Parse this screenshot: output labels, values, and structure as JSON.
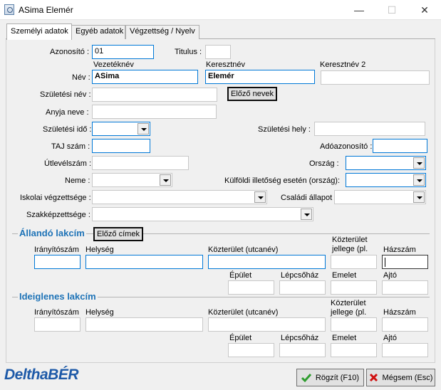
{
  "window": {
    "title": "ASima Elemér",
    "minimize": "—",
    "maximize": "☐",
    "close": "✕"
  },
  "tabs": [
    {
      "label": "Személyi adatok"
    },
    {
      "label": "Egyéb adatok"
    },
    {
      "label": "Végzettség / Nyelv"
    }
  ],
  "form": {
    "azonosito_label": "Azonosító :",
    "azonosito_value": "01",
    "titulus_label": "Titulus :",
    "titulus_value": "",
    "vezeteknev_caption": "Vezetéknév",
    "keresztnev_caption": "Keresztnév",
    "keresztnev2_caption": "Keresztnév 2",
    "nev_label": "Név :",
    "vezeteknev_value": "ASima",
    "keresztnev_value": "Elemér",
    "keresztnev2_value": "",
    "szuletesi_nev_label": "Születési név :",
    "szuletesi_nev_value": "",
    "elozo_nevek_button": "Előző nevek",
    "anyja_neve_label": "Anyja neve :",
    "anyja_neve_value": "",
    "szuletesi_ido_label": "Születési idő :",
    "szuletesi_ido_value": "",
    "szuletesi_hely_label": "Születési hely :",
    "szuletesi_hely_value": "",
    "taj_label": "TAJ szám :",
    "taj_value": "",
    "adoazonosito_label": "Adóazonosító :",
    "adoazonosito_value": "",
    "utlevel_label": "Útlevélszám :",
    "utlevel_value": "",
    "orszag_label": "Ország :",
    "orszag_value": "",
    "neme_label": "Neme :",
    "neme_value": "",
    "kulfoldi_label": "Külföldi illetőség esetén (ország):",
    "kulfoldi_value": "",
    "iskolai_label": "Iskolai végzettsége :",
    "iskolai_value": "",
    "csaladi_label": "Családi állapot :",
    "csaladi_value": "",
    "szakkepzettseg_label": "Szakképzettsége :",
    "szakkepzettseg_value": ""
  },
  "allando": {
    "title": "Állandó lakcím",
    "elozo_cimek_button": "Előző címek",
    "iranyitoszam": "Irányítószám",
    "helyseg": "Helység",
    "kozterulet": "Közterület (utcanév)",
    "jellege": "Közterület jellege (pl.",
    "hazszam": "Házszám",
    "epulet": "Épület",
    "lepcsohaz": "Lépcsőház",
    "emelet": "Emelet",
    "ajto": "Ajtó"
  },
  "ideiglenes": {
    "title": "Ideiglenes lakcím",
    "iranyitoszam": "Irányítószám",
    "helyseg": "Helység",
    "kozterulet": "Közterület (utcanév)",
    "jellege": "Közterület jellege (pl.",
    "hazszam": "Házszám",
    "epulet": "Épület",
    "lepcsohaz": "Lépcsőház",
    "emelet": "Emelet",
    "ajto": "Ajtó"
  },
  "footer": {
    "logo": "DelthaBÉR",
    "save_button": "Rögzít (F10)",
    "cancel_button": "Mégsem (Esc)"
  }
}
